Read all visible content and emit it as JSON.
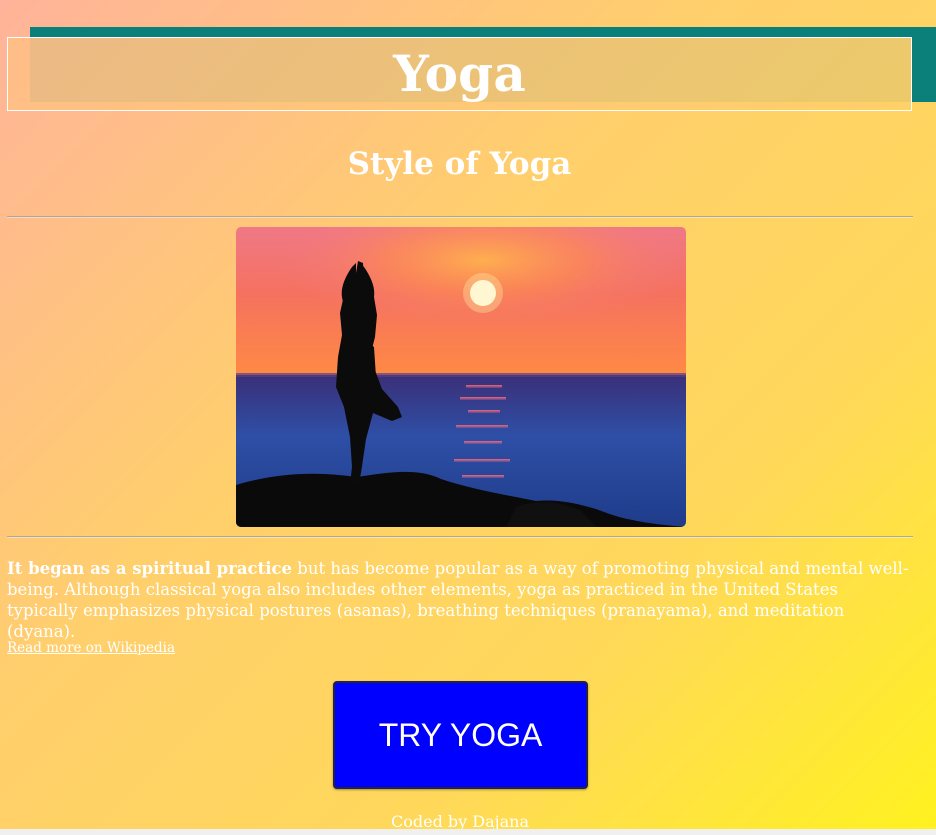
{
  "header": {
    "title": "Yoga",
    "subtitle": "Style of Yoga"
  },
  "image": {
    "description_icon": "yoga-sunset-photo"
  },
  "content": {
    "bold_intro": "It began as a spiritual practice",
    "paragraph_rest": " but has become popular as a way of promoting physical and mental well-being. Although classical yoga also includes other elements, yoga as practiced in the United States typically emphasizes physical postures (asanas), breathing techniques (pranayama), and meditation (dyana).",
    "link_text": "Read more on Wikipedia"
  },
  "cta": {
    "button_label": "TRY YOGA",
    "button_color": "#0000ff"
  },
  "footer": {
    "credit": "Coded by Dajana"
  },
  "colors": {
    "accent_teal": "#0b7f7a",
    "gradient_start": "#ffb39a",
    "gradient_end": "#fff21f",
    "text": "#ffffff"
  }
}
